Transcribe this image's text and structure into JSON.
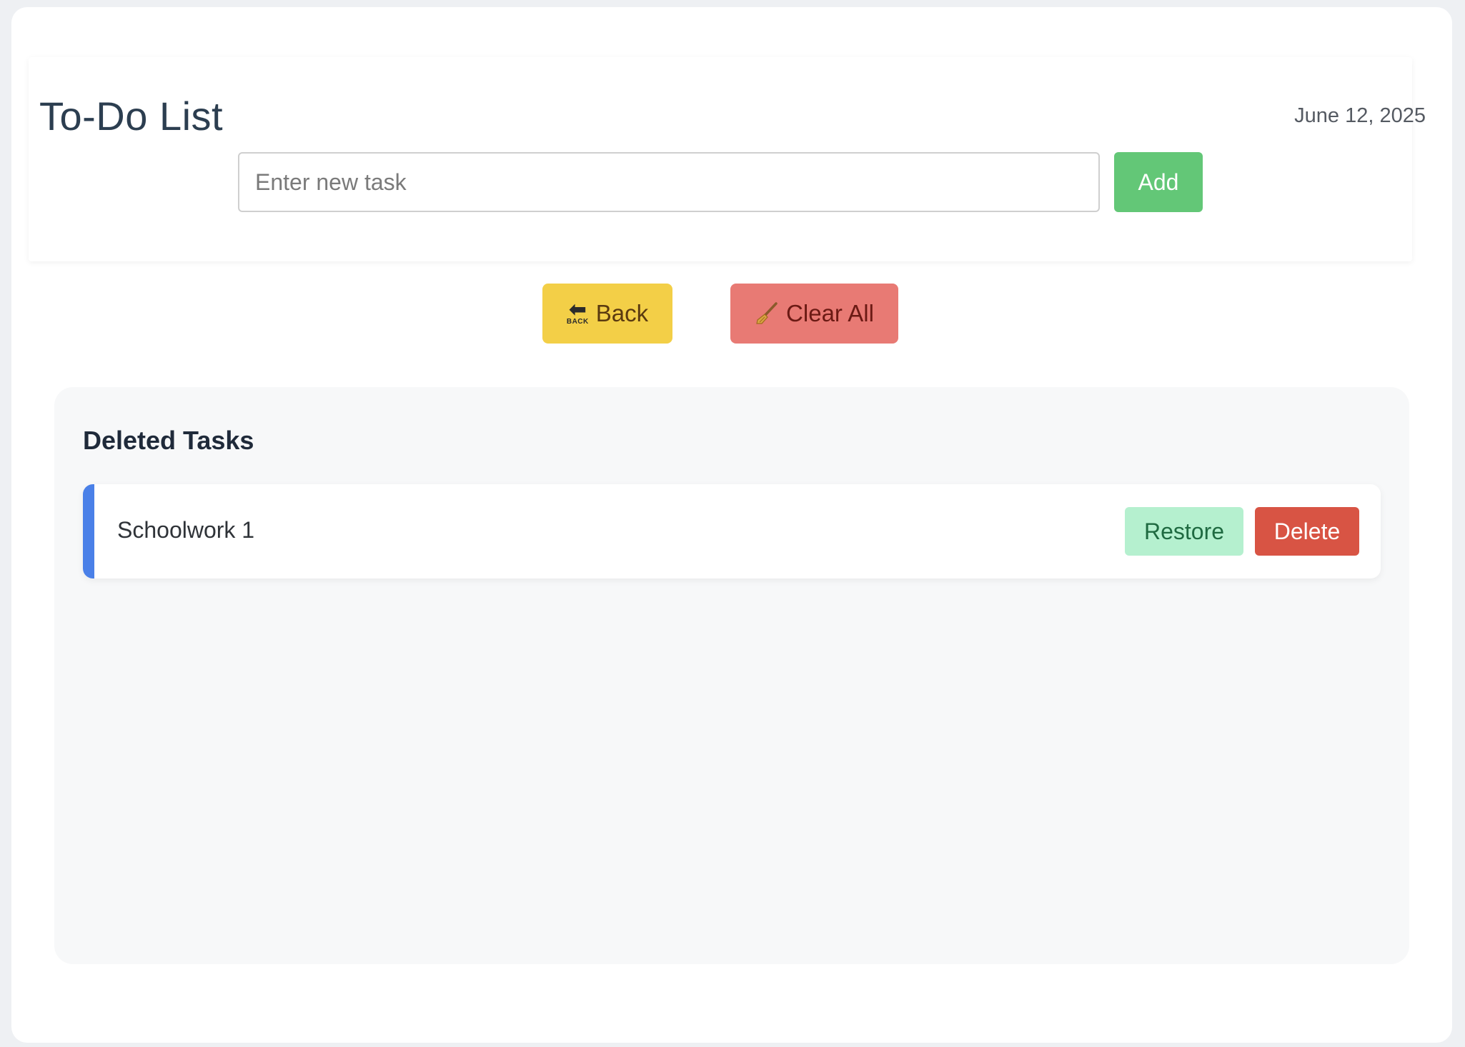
{
  "header": {
    "title": "To-Do List",
    "date": "June 12, 2025"
  },
  "new_task": {
    "placeholder": "Enter new task",
    "value": "",
    "add_label": "Add"
  },
  "actions": {
    "back_label": "Back",
    "back_icon": "back-arrow-icon",
    "back_icon_text": "BACK",
    "clear_all_label": "Clear All",
    "clear_all_icon": "broom-icon"
  },
  "deleted": {
    "title": "Deleted Tasks",
    "tasks": [
      {
        "name": "Schoolwork 1",
        "restore_label": "Restore",
        "delete_label": "Delete"
      }
    ]
  },
  "colors": {
    "add": "#63c777",
    "back": "#f3cf47",
    "clear_all": "#e87a74",
    "restore": "#b5f0cf",
    "delete": "#d85444",
    "accent": "#4a80e8"
  }
}
